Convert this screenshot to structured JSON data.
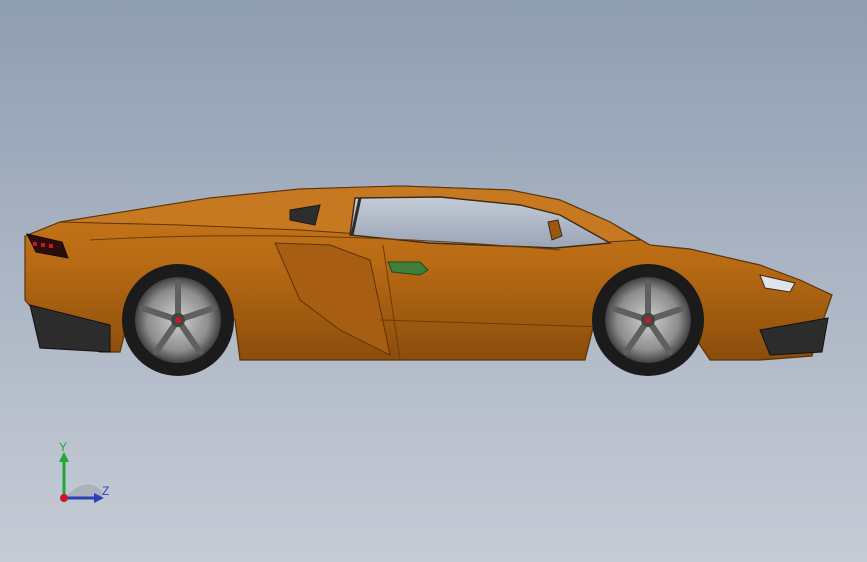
{
  "viewport": {
    "background_top": "#8f9db2",
    "background_bottom": "#c6ccd6",
    "model": {
      "body_color": "#b86a14",
      "body_shade": "#8a4d0c",
      "window_color": "#aeb7c6",
      "side_badge_color": "#3f7f3a"
    }
  },
  "triad": {
    "y_label": "Y",
    "z_label": "Z",
    "y_color": "#1fa83a",
    "z_color": "#2a3fb8",
    "x_color": "#c8182a"
  }
}
